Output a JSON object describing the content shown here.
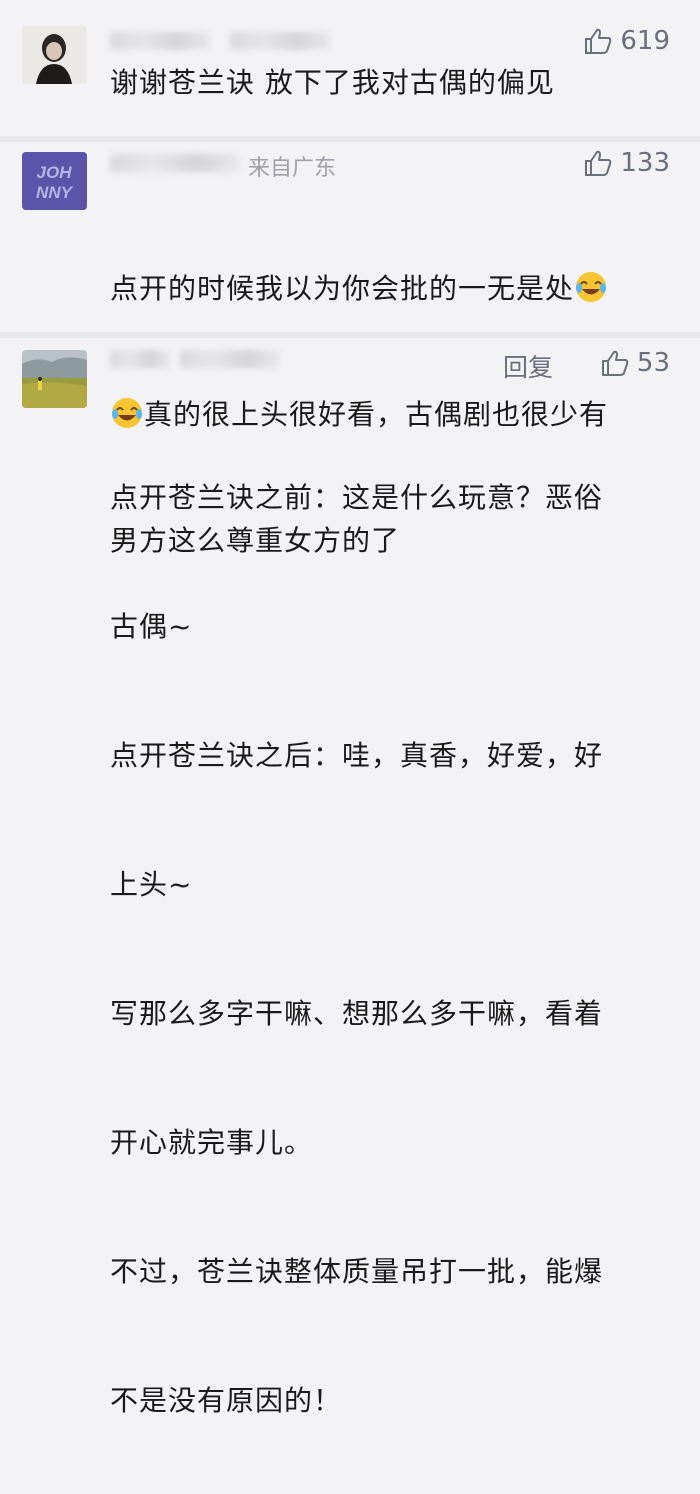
{
  "comments": [
    {
      "likes": "619",
      "text": "谢谢苍兰诀 放下了我对古偶的偏见"
    },
    {
      "location": "来自广东",
      "likes": "133",
      "text_line1": "点开的时候我以为你会批的一无是处",
      "text_line2": "真的很上头很好看，古偶剧也很少有",
      "text_line3": "男方这么尊重女方的了",
      "avatar_text": "JOH NNY"
    },
    {
      "reply_label": "回复",
      "likes": "53",
      "lines": [
        "点开苍兰诀之前：这是什么玩意？恶俗",
        "古偶~",
        "点开苍兰诀之后：哇，真香，好爱，好",
        "上头~",
        "写那么多字干嘛、想那么多干嘛，看着",
        "开心就完事儿。",
        "不过，苍兰诀整体质量吊打一批，能爆",
        "不是没有原因的！"
      ]
    }
  ],
  "colors": {
    "background": "#f3f3f5",
    "meta_gray": "#6a6f7b",
    "avatar2_bg": "#5b54a8"
  },
  "icons": [
    "thumbs-up-icon",
    "laughing-crying-emoji-icon"
  ]
}
